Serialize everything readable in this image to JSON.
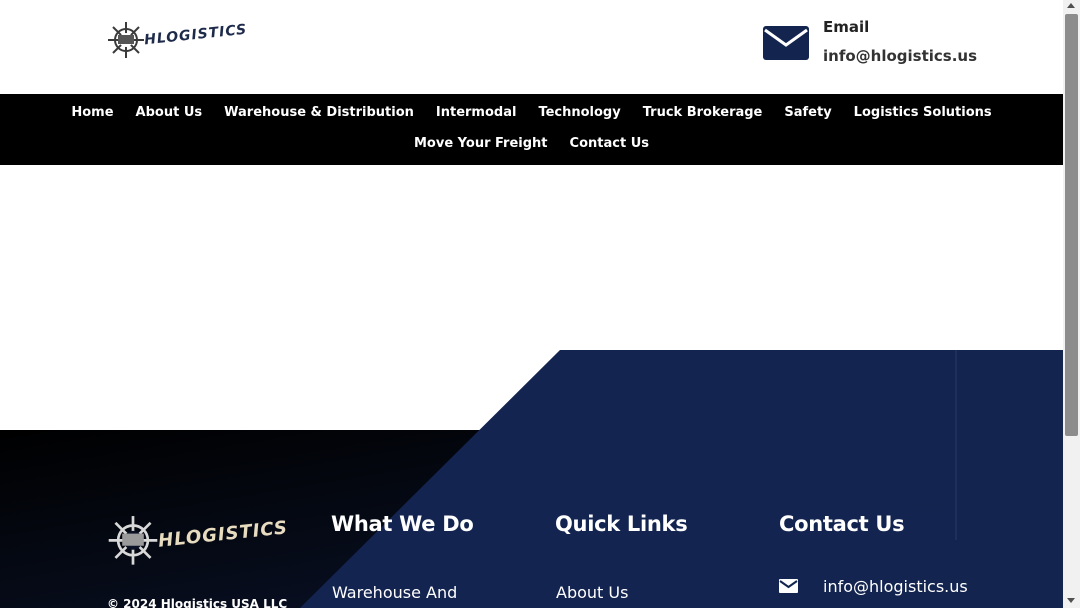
{
  "header": {
    "logo_text": "HLOGISTICS",
    "email_title": "Email",
    "email_value": "info@hlogistics.us"
  },
  "nav": {
    "row1": [
      "Home",
      "About Us",
      "Warehouse & Distribution",
      "Intermodal",
      "Technology",
      "Truck Brokerage",
      "Safety",
      "Logistics Solutions"
    ],
    "row2": [
      "Move Your Freight",
      "Contact Us"
    ]
  },
  "footer": {
    "logo_text": "HLOGISTICS",
    "copyright": "© 2024 Hlogistics USA LLC",
    "what_we_do": {
      "heading": "What We Do",
      "first_link": "Warehouse And"
    },
    "quick_links": {
      "heading": "Quick Links",
      "first_link": "About Us"
    },
    "contact": {
      "heading": "Contact Us",
      "email": "info@hlogistics.us"
    }
  },
  "colors": {
    "brand_navy": "#13244f",
    "nav_background": "#000000",
    "footer_dark": "#050a18"
  },
  "icons": [
    "ship-wheel-icon",
    "email-icon",
    "envelope-icon",
    "scroll-up-arrow-icon",
    "scroll-down-arrow-icon"
  ]
}
